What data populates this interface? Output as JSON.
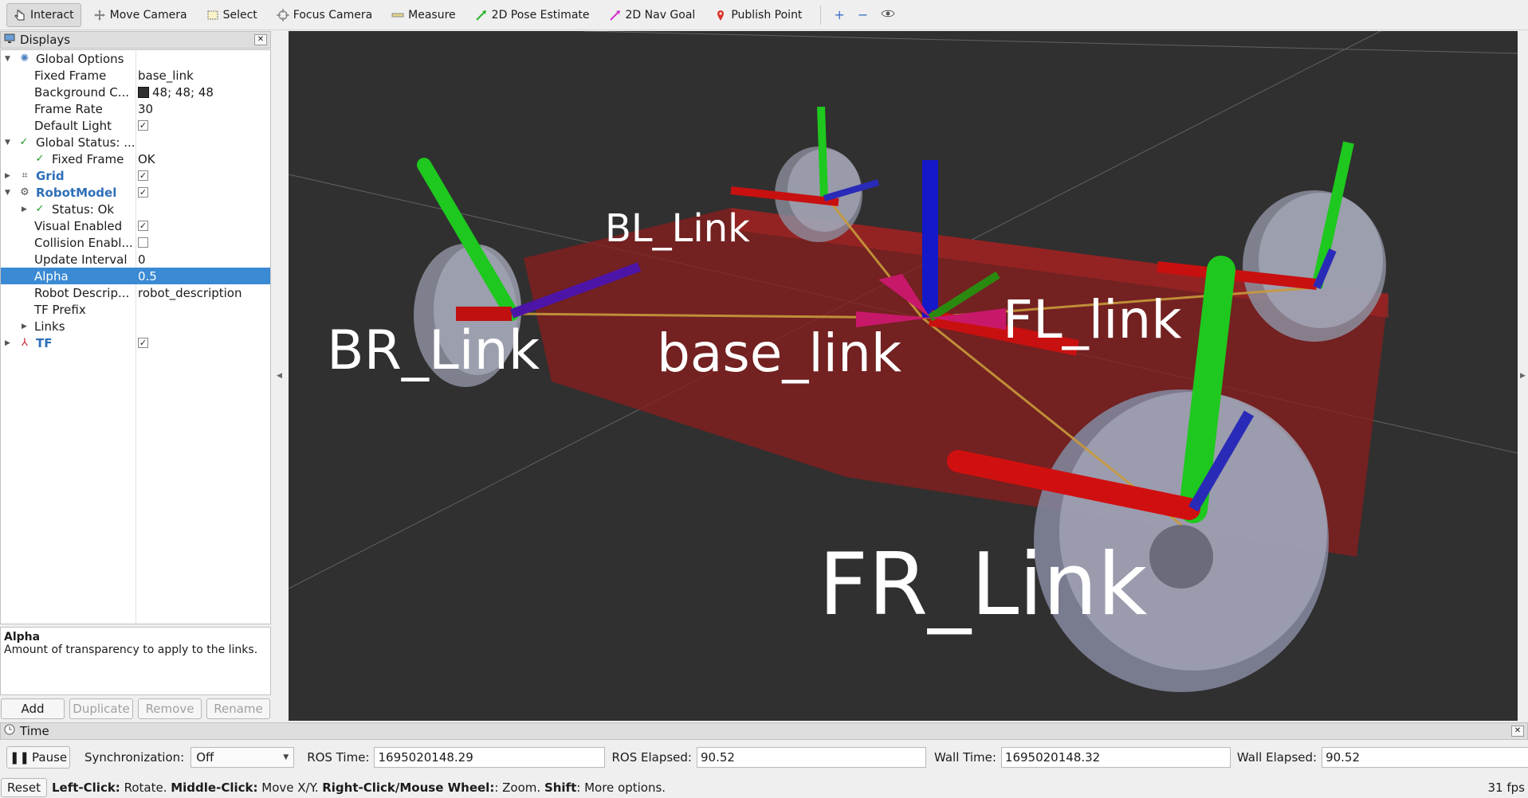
{
  "toolbar": {
    "tools": [
      {
        "label": "Interact",
        "icon": "hand-cursor-icon",
        "active": true
      },
      {
        "label": "Move Camera",
        "icon": "move-arrows-icon"
      },
      {
        "label": "Select",
        "icon": "select-rect-icon"
      },
      {
        "label": "Focus Camera",
        "icon": "focus-target-icon"
      },
      {
        "label": "Measure",
        "icon": "ruler-icon"
      },
      {
        "label": "2D Pose Estimate",
        "icon": "green-arrow-icon"
      },
      {
        "label": "2D Nav Goal",
        "icon": "magenta-arrow-icon"
      },
      {
        "label": "Publish Point",
        "icon": "map-pin-icon"
      }
    ],
    "add_tool": "+",
    "remove_tool": "−",
    "view_tool": "eye-icon"
  },
  "displays": {
    "title": "Displays",
    "rows": [
      {
        "name": "Global Options",
        "value": ""
      },
      {
        "name": "Fixed Frame",
        "value": "base_link"
      },
      {
        "name": "Background C...",
        "value": "48; 48; 48"
      },
      {
        "name": "Frame Rate",
        "value": "30"
      },
      {
        "name": "Default Light",
        "value": ""
      },
      {
        "name": "Global Status: ...",
        "value": ""
      },
      {
        "name": "Fixed Frame",
        "value": "OK"
      },
      {
        "name": "Grid",
        "value": ""
      },
      {
        "name": "RobotModel",
        "value": ""
      },
      {
        "name": "Status: Ok",
        "value": ""
      },
      {
        "name": "Visual Enabled",
        "value": ""
      },
      {
        "name": "Collision Enabl...",
        "value": ""
      },
      {
        "name": "Update Interval",
        "value": "0"
      },
      {
        "name": "Alpha",
        "value": "0.5"
      },
      {
        "name": "Robot Descrip...",
        "value": "robot_description"
      },
      {
        "name": "TF Prefix",
        "value": ""
      },
      {
        "name": "Links",
        "value": ""
      },
      {
        "name": "TF",
        "value": ""
      }
    ],
    "description_title": "Alpha",
    "description_text": "Amount of transparency to apply to the links.",
    "buttons": {
      "add": "Add",
      "duplicate": "Duplicate",
      "remove": "Remove",
      "rename": "Rename"
    }
  },
  "viewport": {
    "labels": {
      "bl": "BL_Link",
      "br": "BR_Link",
      "base": "base_link",
      "fl": "FL_link",
      "fr": "FR_Link"
    },
    "background_color": "#303030"
  },
  "time": {
    "title": "Time",
    "pause_label": "Pause",
    "sync_label": "Synchronization:",
    "sync_value": "Off",
    "ros_time_label": "ROS Time:",
    "ros_time": "1695020148.29",
    "ros_elapsed_label": "ROS Elapsed:",
    "ros_elapsed": "90.52",
    "wall_time_label": "Wall Time:",
    "wall_time": "1695020148.32",
    "wall_elapsed_label": "Wall Elapsed:",
    "wall_elapsed": "90.52"
  },
  "status": {
    "reset_label": "Reset",
    "left_click_key": "Left-Click:",
    "left_click_text": " Rotate. ",
    "middle_click_key": "Middle-Click:",
    "middle_click_text": " Move X/Y. ",
    "right_click_key": "Right-Click/Mouse Wheel:",
    "right_click_text": ": Zoom. ",
    "shift_key": "Shift",
    "shift_text": ": More options.",
    "fps": "31 fps"
  }
}
